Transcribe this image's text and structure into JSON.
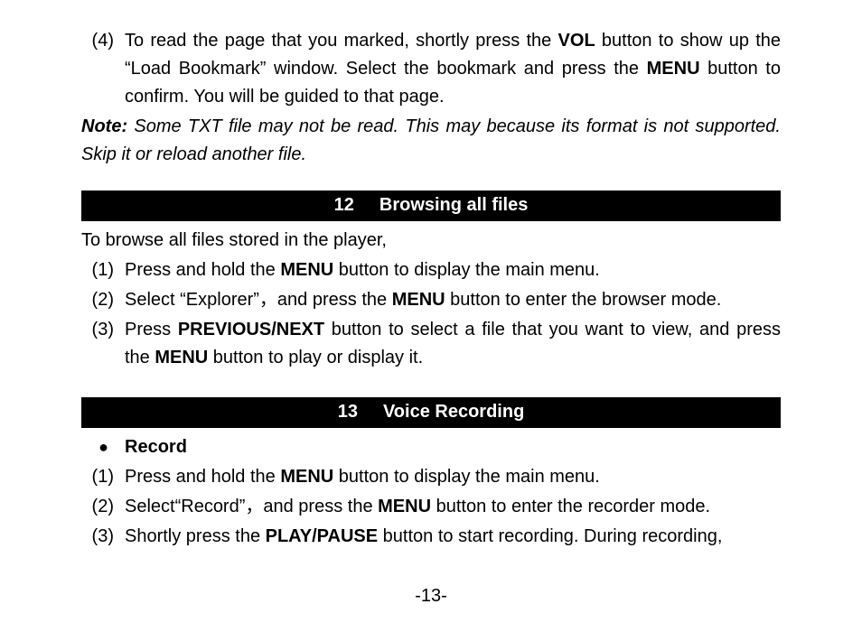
{
  "top": {
    "item4_num": "(4)",
    "item4_a": "To read the page that you marked, shortly press the ",
    "item4_b": "VOL",
    "item4_c": " button to show up the “Load Bookmark” window. Select the bookmark and press the ",
    "item4_d": "MENU",
    "item4_e": " button to confirm. You will be guided to that page.",
    "note_label": "Note:",
    "note_body": " Some TXT file may not be read. This may because its format is not supported. Skip it or reload another file."
  },
  "sec12": {
    "num": "12",
    "title": "Browsing all files",
    "intro": "To browse all files stored in the player,",
    "i1_num": "(1)",
    "i1_a": "Press and hold the ",
    "i1_b": "MENU",
    "i1_c": " button to display the main menu.",
    "i2_num": "(2)",
    "i2_a": "Select “Explorer”，and press the ",
    "i2_b": "MENU",
    "i2_c": " button to enter the browser mode.",
    "i3_num": "(3)",
    "i3_a": "Press ",
    "i3_b": "PREVIOUS/NEXT",
    "i3_c": " button to select a file that you want to view, and press the ",
    "i3_d": "MENU",
    "i3_e": " button to play or display it."
  },
  "sec13": {
    "num": "13",
    "title": "Voice Recording",
    "bullet": "Record",
    "i1_num": "(1)",
    "i1_a": "Press and hold the ",
    "i1_b": "MENU",
    "i1_c": " button to display the main menu.",
    "i2_num": "(2)",
    "i2_a": "Select“Record”，and press the ",
    "i2_b": "MENU",
    "i2_c": " button to enter the recorder mode.",
    "i3_num": "(3)",
    "i3_a": "Shortly press the ",
    "i3_b": "PLAY/PAUSE",
    "i3_c": " button to start recording. During recording,"
  },
  "page_number": "-13-"
}
